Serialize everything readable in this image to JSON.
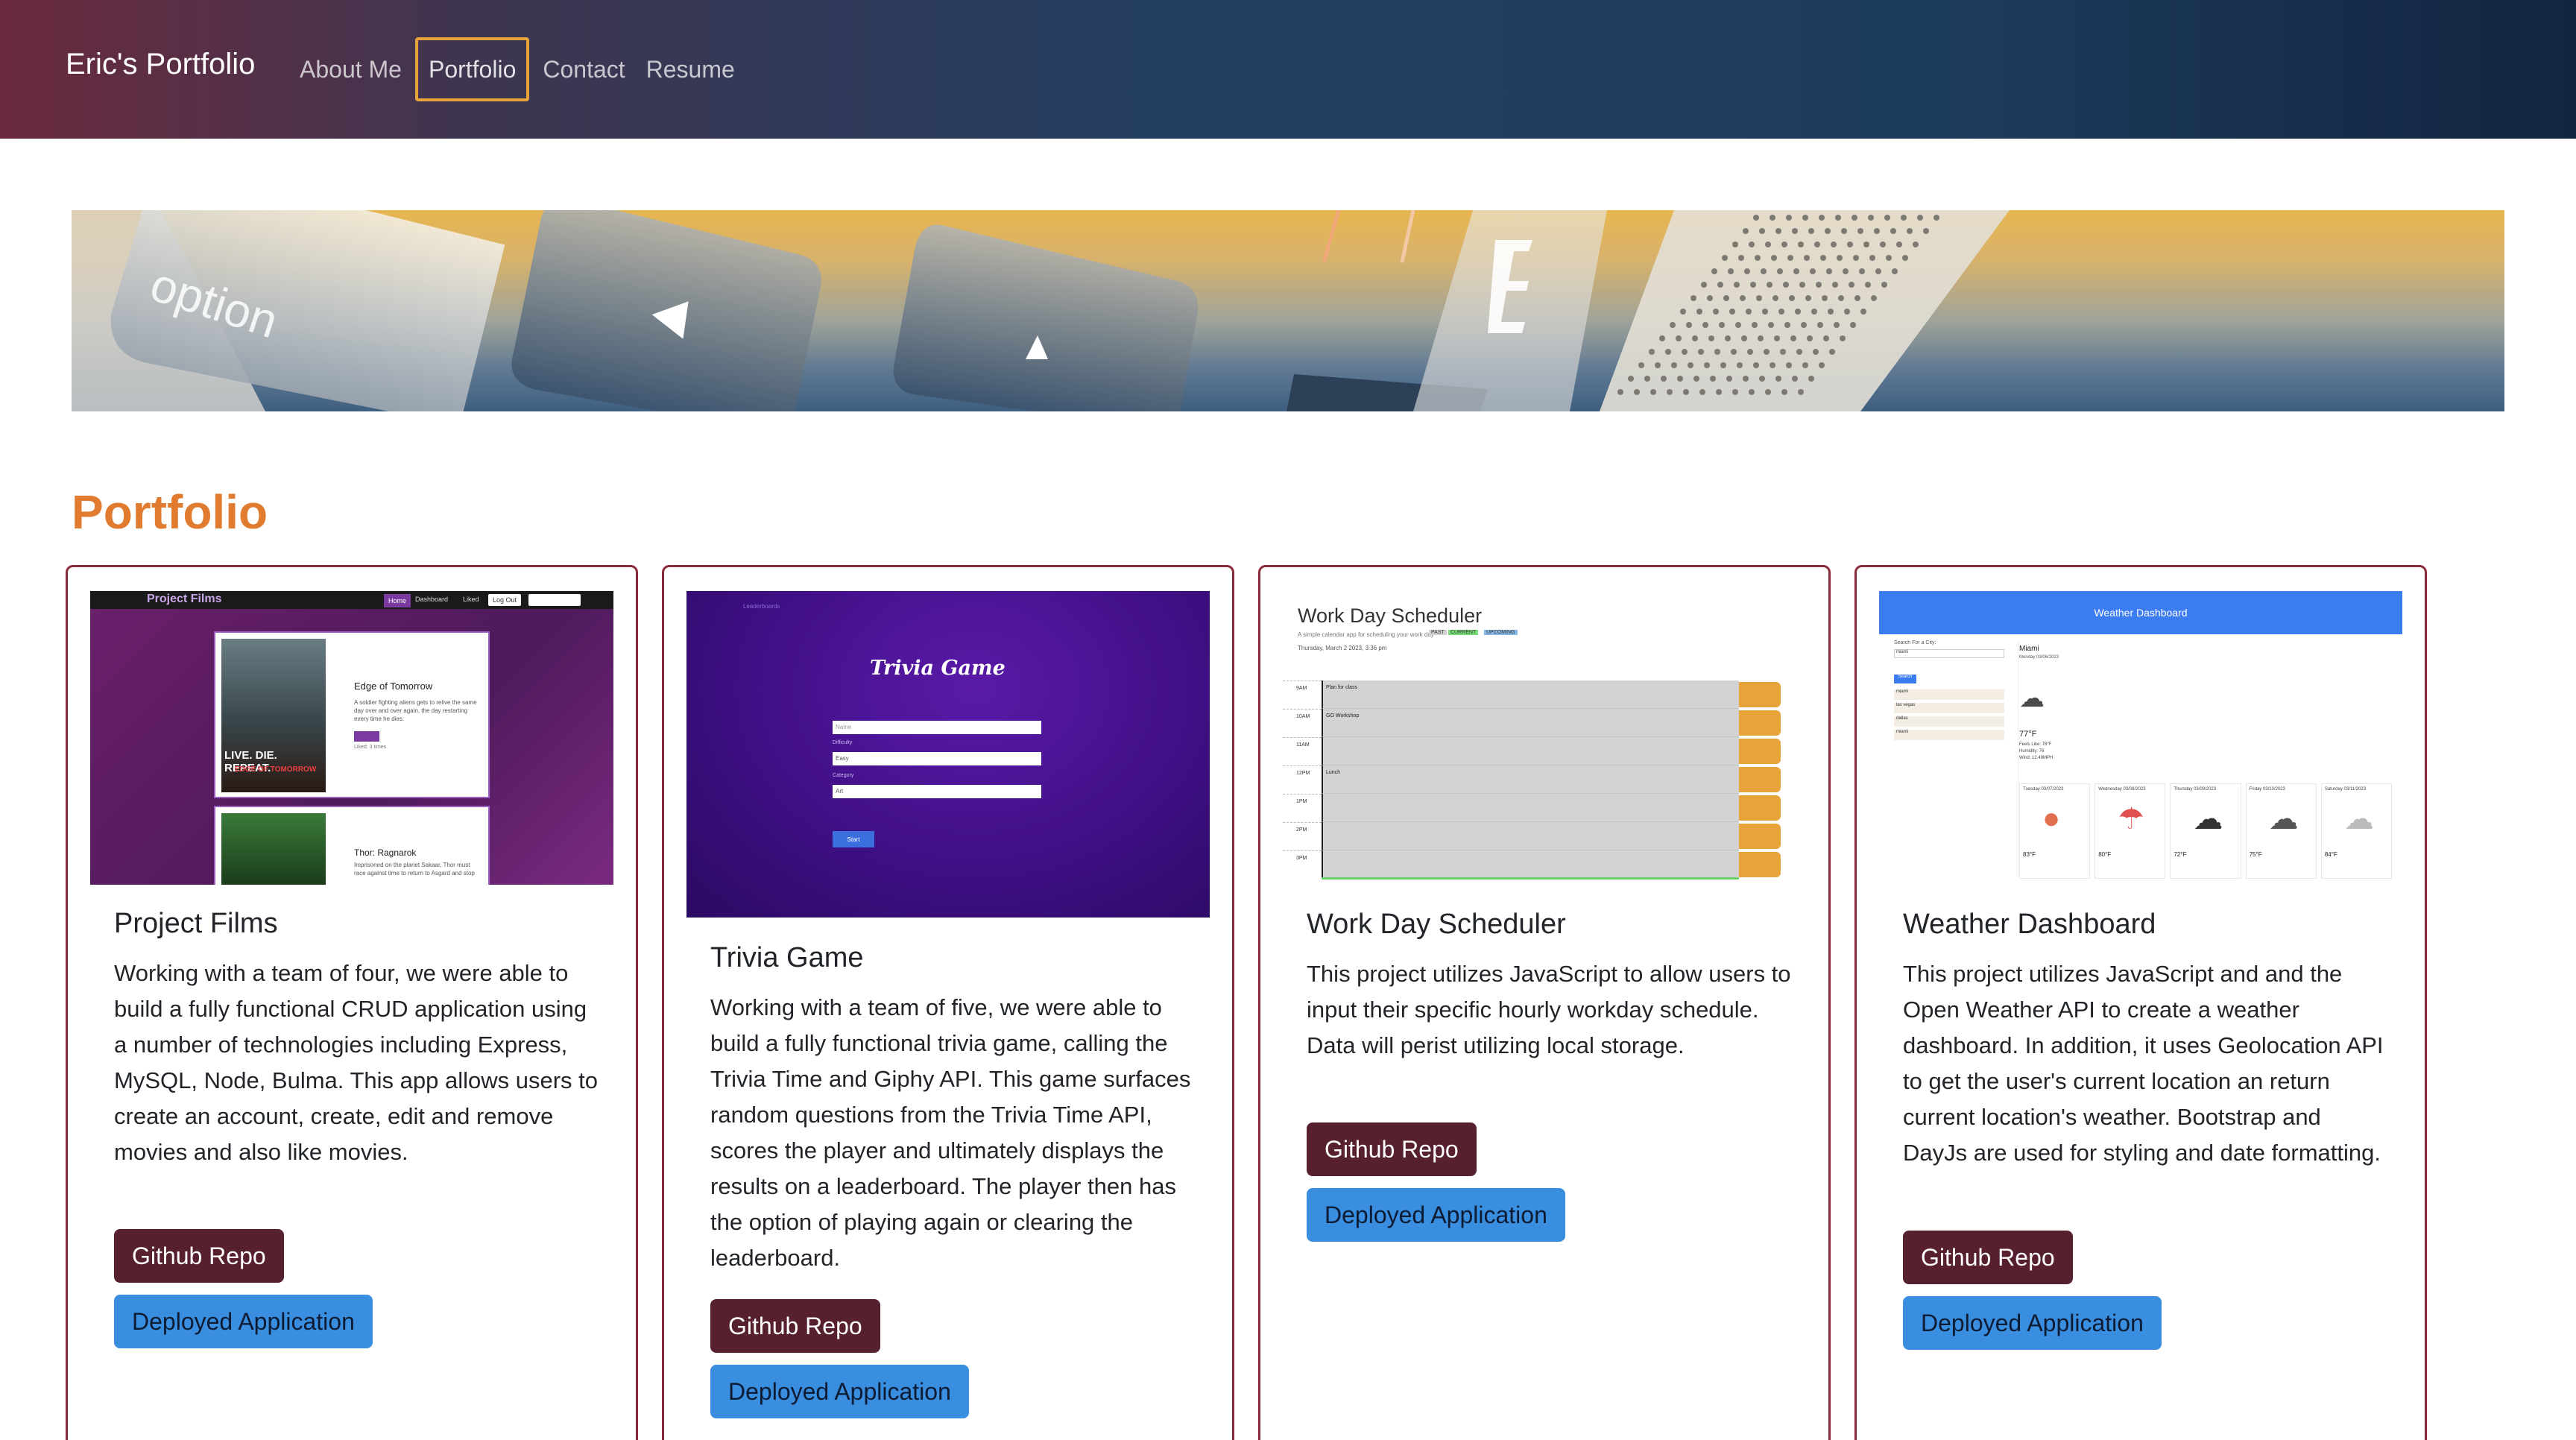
{
  "nav": {
    "brand": "Eric's Portfolio",
    "links": [
      "About Me",
      "Portfolio",
      "Contact",
      "Resume"
    ]
  },
  "hero": {
    "key_label": "option"
  },
  "section_title": "Portfolio",
  "colors": {
    "accent": "#e07b2f",
    "card_border": "#8a2a3a",
    "repo_button": "#57202f",
    "app_button": "#3a8ee0"
  },
  "cards": [
    {
      "title": "Project Films",
      "text": "Working with a team of four, we were able to build a fully functional CRUD application using a number of technologies including Express, MySQL, Node, Bulma. This app allows users to create an account, create, edit and remove movies and also like movies.",
      "repo_label": "Github Repo",
      "app_label": "Deployed Application",
      "shot": {
        "brand": "Project Films",
        "nav": [
          "Home",
          "Dashboard",
          "Liked",
          "Log Out"
        ],
        "movie1": "Edge of Tomorrow",
        "movie1_desc": "A soldier fighting aliens gets to relive the same day over and over again, the day restarting every time he dies.",
        "movie1_poster": "LIVE. DIE. REPEAT.",
        "movie1_sub": "EDGE OF TOMORROW",
        "movie1_likes": "Liked: 3 times",
        "movie2": "Thor: Ragnarok",
        "movie2_desc": "Imprisoned on the planet Sakaar, Thor must race against time to return to Asgard and stop"
      }
    },
    {
      "title": "Trivia Game",
      "text": "Working with a team of five, we were able to build a fully functional trivia game, calling the Trivia Time and Giphy API. This game surfaces random questions from the Trivia Time API, scores the player and ultimately displays the results on a leaderboard. The player then has the option of playing again or clearing the leaderboard.",
      "repo_label": "Github Repo",
      "app_label": "Deployed Application",
      "shot": {
        "link": "Leaderboards",
        "heading": "Trivia Game",
        "field1": "Name",
        "label2": "Difficulty",
        "field2": "Easy",
        "label3": "Category",
        "field3": "Art",
        "button": "Start"
      }
    },
    {
      "title": "Work Day Scheduler",
      "text": "This project utilizes JavaScript to allow users to input their specific hourly workday schedule. Data will perist utilizing local storage.",
      "repo_label": "Github Repo",
      "app_label": "Deployed Application",
      "shot": {
        "heading": "Work Day Scheduler",
        "subtitle": "A simple calendar app for scheduling your work day",
        "legend": [
          "PAST",
          "CURRENT",
          "UPCOMING"
        ],
        "date": "Thursday, March 2 2023, 3:36 pm",
        "hours": [
          "9AM",
          "10AM",
          "11AM",
          "12PM",
          "1PM",
          "2PM",
          "3PM"
        ],
        "entries": [
          "Plan for class",
          "GO Workshop",
          "",
          "Lunch",
          "",
          "",
          ""
        ]
      }
    },
    {
      "title": "Weather Dashboard",
      "text": "This project utilizes JavaScript and and the Open Weather API to create a weather dashboard. In addition, it uses Geolocation API to get the user's current location an return current location's weather. Bootstrap and DayJs are used for styling and date formatting.",
      "repo_label": "Github Repo",
      "app_label": "Deployed Application",
      "shot": {
        "header": "Weather Dashboard",
        "search_label": "Search For a City:",
        "search_value": "miami",
        "search_button": "Search",
        "history": [
          "miami",
          "las vegas",
          "dallas",
          "miami"
        ],
        "city": "Miami",
        "date": "Monday 03/06/2023",
        "temp": "77°F",
        "details": [
          "Feels Like: 78°F",
          "Humidity: 76",
          "Wind: 12.49MPH"
        ],
        "forecast_days": [
          "Tuesday 03/07/2023",
          "Wednesday 03/08/2023",
          "Thursday 03/09/2023",
          "Friday 03/10/2023",
          "Saturday 03/11/2023"
        ],
        "forecast_temps": [
          "83°F",
          "80°F",
          "72°F",
          "75°F",
          "84°F"
        ]
      }
    }
  ]
}
